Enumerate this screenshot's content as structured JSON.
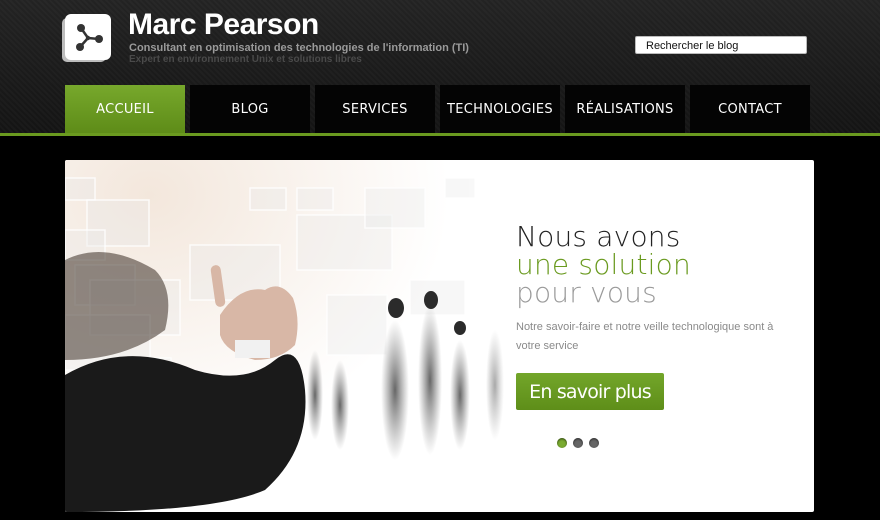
{
  "header": {
    "title": "Marc Pearson",
    "subtitle": "Consultant en optimisation des technologies de l'information (TI)",
    "tagline": "Expert en environnement Unix et solutions libres",
    "logo_icon": "share-nodes-icon"
  },
  "search": {
    "placeholder": "Rechercher le blog"
  },
  "nav": {
    "items": [
      {
        "label": "ACCUEIL",
        "active": true
      },
      {
        "label": "BLOG",
        "active": false
      },
      {
        "label": "SERVICES",
        "active": false
      },
      {
        "label": "TECHNOLOGIES",
        "active": false
      },
      {
        "label": "RÉALISATIONS",
        "active": false
      },
      {
        "label": "CONTACT",
        "active": false
      }
    ]
  },
  "slider": {
    "heading_line1": "Nous avons",
    "heading_line2": "une solution",
    "heading_line3": "pour vous",
    "description": "Notre savoir-faire et notre veille technologique sont à votre service",
    "cta_label": "En savoir plus",
    "slide_count": 3,
    "active_slide": 1
  },
  "colors": {
    "accent": "#6a9a1f",
    "background": "#000000",
    "header": "#1c1c1c"
  }
}
